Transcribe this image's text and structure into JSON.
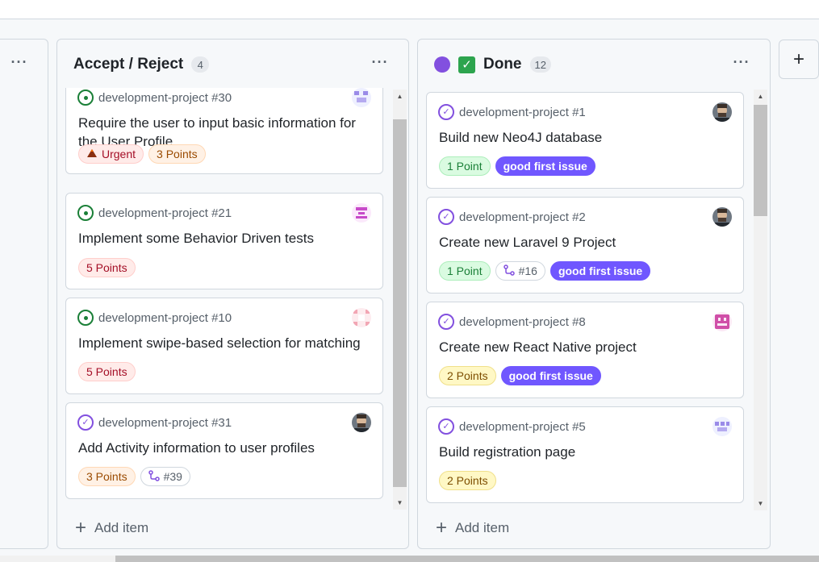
{
  "colors": {
    "done_status_dot": "#8250df",
    "done_check": "#2da44e",
    "open_issue": "#1a7f37",
    "closed_issue": "#8250df",
    "good_first_issue": "#7057ff"
  },
  "columns": {
    "left": {
      "menu_label": "···"
    },
    "accept": {
      "title": "Accept / Reject",
      "count": "4",
      "menu_label": "···",
      "add_item_label": "Add item",
      "add_item_icon": "plus-icon",
      "cards": [
        {
          "repo": "development-project #30",
          "title": "Require the user to input basic information for the User Profile",
          "status": "open-issue-icon",
          "tag1": "Urgent",
          "tag1_icon": "volcano-icon",
          "tag2": "3 Points"
        },
        {
          "repo": "development-project #21",
          "title": "Implement some Behavior Driven tests",
          "status": "open-issue-icon",
          "tag1": "5 Points"
        },
        {
          "repo": "development-project #10",
          "title": "Implement swipe-based selection for matching",
          "status": "open-issue-icon",
          "tag1": "5 Points"
        },
        {
          "repo": "development-project #31",
          "title": "Add Activity information to user profiles",
          "status": "closed-issue-icon",
          "tag1": "3 Points",
          "tag2": "#39",
          "tag2_icon": "pull-request-icon"
        }
      ]
    },
    "done": {
      "title": "Done",
      "count": "12",
      "menu_label": "···",
      "add_item_label": "Add item",
      "add_item_icon": "plus-icon",
      "cards": [
        {
          "repo": "development-project #1",
          "title": "Build new Neo4J database",
          "status": "closed-issue-icon",
          "tag1": "1 Point",
          "tag2": "good first issue"
        },
        {
          "repo": "development-project #2",
          "title": "Create new Laravel 9 Project",
          "status": "closed-issue-icon",
          "tag1": "1 Point",
          "tag2": "#16",
          "tag2_icon": "pull-request-icon",
          "tag3": "good first issue"
        },
        {
          "repo": "development-project #8",
          "title": "Create new React Native project",
          "status": "closed-issue-icon",
          "tag1": "2 Points",
          "tag2": "good first issue"
        },
        {
          "repo": "development-project #5",
          "title": "Build registration page",
          "status": "closed-issue-icon",
          "tag1": "2 Points"
        }
      ]
    }
  },
  "add_column": {
    "label": "+"
  }
}
